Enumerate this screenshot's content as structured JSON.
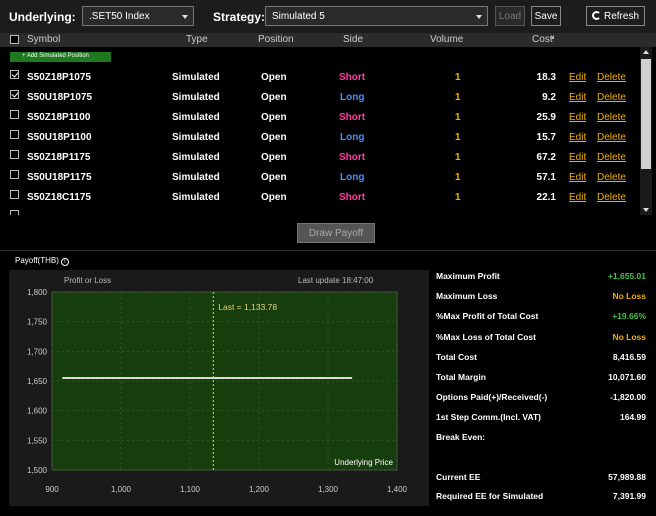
{
  "toolbar": {
    "underlying_label": "Underlying:",
    "underlying_value": ".SET50 Index",
    "strategy_label": "Strategy:",
    "strategy_value": "Simulated 5",
    "load_label": "Load",
    "save_label": "Save",
    "refresh_label": "Refresh",
    "refresh_icon": "refresh-icon"
  },
  "table": {
    "headers": [
      "Symbol",
      "Type",
      "Position",
      "Side",
      "Volume",
      "Cost"
    ],
    "add_label": "+ Add Simulated Position",
    "edit_label": "Edit",
    "delete_label": "Delete",
    "rows": [
      {
        "symbol": "S50Z18P1075",
        "type": "Simulated",
        "position": "Open",
        "side": "Short",
        "volume": "1",
        "cost": "18.3",
        "checked": true
      },
      {
        "symbol": "S50U18P1075",
        "type": "Simulated",
        "position": "Open",
        "side": "Long",
        "volume": "1",
        "cost": "9.2",
        "checked": true
      },
      {
        "symbol": "S50Z18P1100",
        "type": "Simulated",
        "position": "Open",
        "side": "Short",
        "volume": "1",
        "cost": "25.9",
        "checked": false
      },
      {
        "symbol": "S50U18P1100",
        "type": "Simulated",
        "position": "Open",
        "side": "Long",
        "volume": "1",
        "cost": "15.7",
        "checked": false
      },
      {
        "symbol": "S50Z18P1175",
        "type": "Simulated",
        "position": "Open",
        "side": "Short",
        "volume": "1",
        "cost": "67.2",
        "checked": false
      },
      {
        "symbol": "S50U18P1175",
        "type": "Simulated",
        "position": "Open",
        "side": "Long",
        "volume": "1",
        "cost": "57.1",
        "checked": false
      },
      {
        "symbol": "S50Z18C1175",
        "type": "Simulated",
        "position": "Open",
        "side": "Short",
        "volume": "1",
        "cost": "22.1",
        "checked": false
      }
    ]
  },
  "draw_payoff_label": "Draw Payoff",
  "payoff": {
    "title": "Payoff(THB)",
    "info_glyph": "i",
    "last_update": "Last update 18:47:00"
  },
  "chart_data": {
    "type": "line",
    "ylabel": "Profit or Loss",
    "xlabel": "Underlying Price",
    "xlim": [
      900,
      1400
    ],
    "ylim": [
      1500,
      1800
    ],
    "x_ticks": [
      "900",
      "1,000",
      "1,100",
      "1,200",
      "1,300",
      "1,400"
    ],
    "y_ticks": [
      "1,800",
      "1,750",
      "1,700",
      "1,650",
      "1,600",
      "1,550",
      "1,500"
    ],
    "series": [
      {
        "x": [
          915,
          1335
        ],
        "y": [
          1655,
          1655
        ]
      }
    ],
    "marker": {
      "x": 1133.78,
      "label": "Last = 1,133.78"
    },
    "colors": {
      "plot_bg": "#163d0c",
      "line": "#d9d9d9",
      "marker": "#e8d27a"
    }
  },
  "stats": [
    {
      "label": "Maximum Profit",
      "value": "+1,655.01",
      "color": "green"
    },
    {
      "label": "Maximum Loss",
      "value": "No Loss",
      "color": "gold"
    },
    {
      "label": "%Max Profit of Total Cost",
      "value": "+19.66%",
      "color": "green"
    },
    {
      "label": "%Max Loss of Total Cost",
      "value": "No Loss",
      "color": "gold"
    },
    {
      "label": "Total Cost",
      "value": "8,416.59",
      "color": "white"
    },
    {
      "label": "Total Margin",
      "value": "10,071.60",
      "color": "white"
    },
    {
      "label": "Options Paid(+)/Received(-)",
      "value": "-1,820.00",
      "color": "white"
    },
    {
      "label": "1st Step Comm.(Incl. VAT)",
      "value": "164.99",
      "color": "white"
    },
    {
      "label": "Break Even:",
      "value": "",
      "color": "white"
    },
    {
      "label": "Current EE",
      "value": "57,989.88",
      "color": "white"
    },
    {
      "label": "Required EE for Simulated",
      "value": "7,391.99",
      "color": "white"
    }
  ]
}
